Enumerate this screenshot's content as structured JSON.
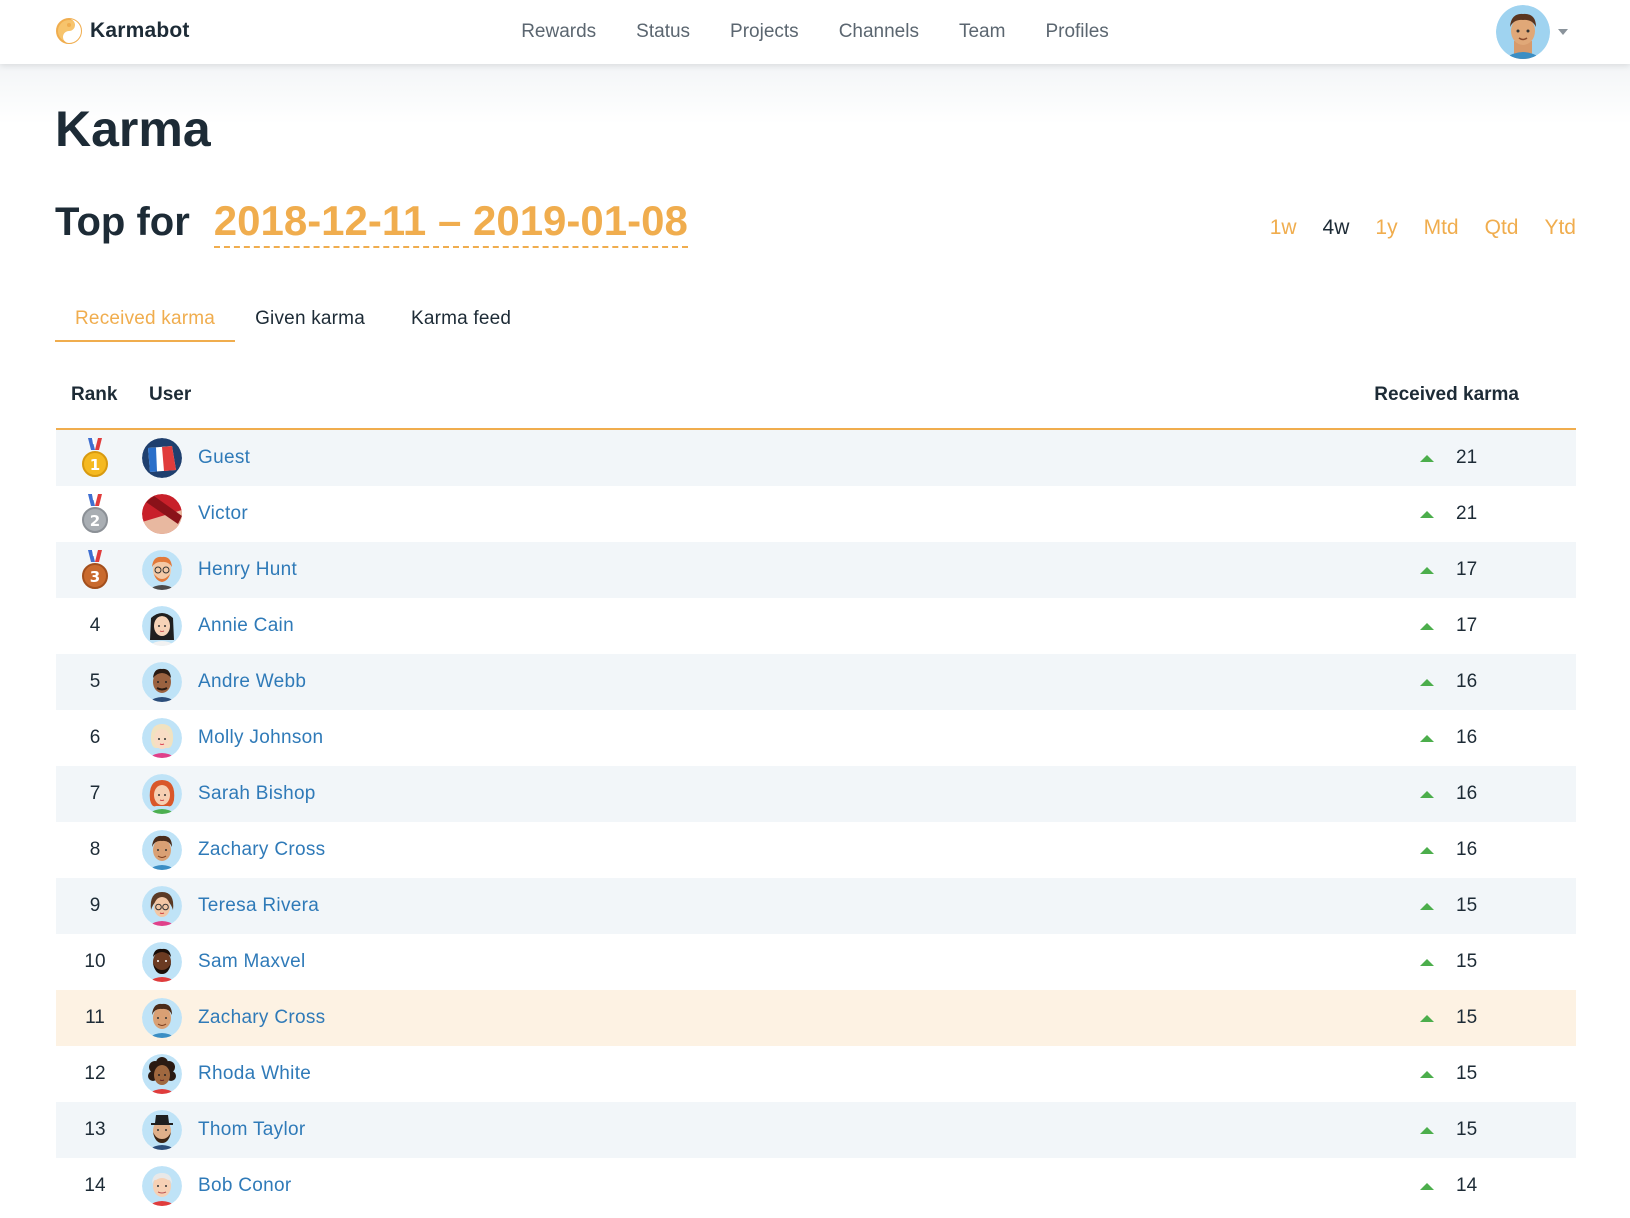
{
  "app": {
    "brand": "Karmabot",
    "nav": [
      "Rewards",
      "Status",
      "Projects",
      "Channels",
      "Team",
      "Profiles"
    ]
  },
  "page": {
    "title": "Karma",
    "top_for_label": "Top for",
    "date_range": "2018-12-11 – 2019-01-08",
    "periods": [
      "1w",
      "4w",
      "1y",
      "Mtd",
      "Qtd",
      "Ytd"
    ],
    "active_period": "4w",
    "tabs": [
      "Received karma",
      "Given karma",
      "Karma feed"
    ],
    "active_tab": "Received karma"
  },
  "table": {
    "headers": {
      "rank": "Rank",
      "user": "User",
      "karma": "Received karma"
    },
    "rows": [
      {
        "rank": "1",
        "medal": "gold",
        "name": "Guest",
        "karma": "21",
        "avatar": "flag"
      },
      {
        "rank": "2",
        "medal": "silver",
        "name": "Victor",
        "karma": "21",
        "avatar": "red"
      },
      {
        "rank": "3",
        "medal": "bronze",
        "name": "Henry Hunt",
        "karma": "17",
        "avatar": "man-orange-glasses"
      },
      {
        "rank": "4",
        "medal": "",
        "name": "Annie Cain",
        "karma": "17",
        "avatar": "woman-black-hair"
      },
      {
        "rank": "5",
        "medal": "",
        "name": "Andre Webb",
        "karma": "16",
        "avatar": "man-dark"
      },
      {
        "rank": "6",
        "medal": "",
        "name": "Molly Johnson",
        "karma": "16",
        "avatar": "woman-blonde"
      },
      {
        "rank": "7",
        "medal": "",
        "name": "Sarah Bishop",
        "karma": "16",
        "avatar": "woman-red-hair"
      },
      {
        "rank": "8",
        "medal": "",
        "name": "Zachary Cross",
        "karma": "16",
        "avatar": "man-brown"
      },
      {
        "rank": "9",
        "medal": "",
        "name": "Teresa Rivera",
        "karma": "15",
        "avatar": "woman-glasses"
      },
      {
        "rank": "10",
        "medal": "",
        "name": "Sam Maxvel",
        "karma": "15",
        "avatar": "man-dark-beard"
      },
      {
        "rank": "11",
        "medal": "",
        "name": "Zachary Cross",
        "karma": "15",
        "avatar": "man-brown",
        "highlight": true
      },
      {
        "rank": "12",
        "medal": "",
        "name": "Rhoda White",
        "karma": "15",
        "avatar": "woman-curly"
      },
      {
        "rank": "13",
        "medal": "",
        "name": "Thom Taylor",
        "karma": "15",
        "avatar": "man-hat-beard"
      },
      {
        "rank": "14",
        "medal": "",
        "name": "Bob Conor",
        "karma": "14",
        "avatar": "man-old"
      }
    ]
  },
  "colors": {
    "accent": "#f0ad4e",
    "link": "#2f7ab8",
    "stripe": "#f2f6f9",
    "highlight": "#fdf2e3",
    "up": "#4cae4c"
  }
}
